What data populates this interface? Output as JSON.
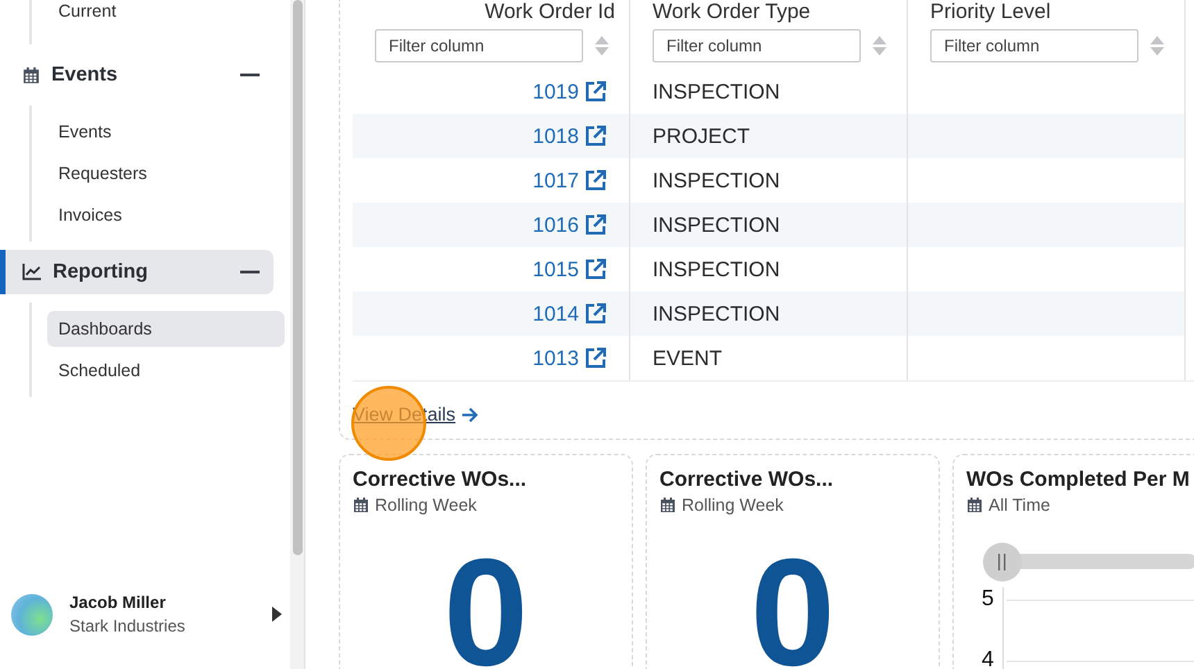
{
  "sidebar": {
    "top_items": [
      {
        "label": "Current",
        "selected": false
      }
    ],
    "groups": [
      {
        "title": "Events",
        "expanded": true,
        "selected": false,
        "items": [
          {
            "label": "Events",
            "selected": false
          },
          {
            "label": "Requesters",
            "selected": false
          },
          {
            "label": "Invoices",
            "selected": false
          }
        ]
      },
      {
        "title": "Reporting",
        "expanded": true,
        "selected": true,
        "items": [
          {
            "label": "Dashboards",
            "selected": true
          },
          {
            "label": "Scheduled",
            "selected": false
          }
        ]
      }
    ],
    "user": {
      "name": "Jacob Miller",
      "company": "Stark Industries"
    }
  },
  "table": {
    "columns": [
      {
        "label": "Work Order Id",
        "placeholder": "Filter column"
      },
      {
        "label": "Work Order Type",
        "placeholder": "Filter column"
      },
      {
        "label": "Priority Level",
        "placeholder": "Filter column"
      }
    ],
    "rows": [
      {
        "id": "1019",
        "type": "INSPECTION"
      },
      {
        "id": "1018",
        "type": "PROJECT"
      },
      {
        "id": "1017",
        "type": "INSPECTION"
      },
      {
        "id": "1016",
        "type": "INSPECTION"
      },
      {
        "id": "1015",
        "type": "INSPECTION"
      },
      {
        "id": "1014",
        "type": "INSPECTION"
      },
      {
        "id": "1013",
        "type": "EVENT"
      }
    ],
    "link": "View Details"
  },
  "cards": [
    {
      "kind": "number",
      "title": "Corrective WOs...",
      "period": "Rolling Week",
      "value": "0"
    },
    {
      "kind": "number",
      "title": "Corrective WOs...",
      "period": "Rolling Week",
      "value": "0"
    },
    {
      "kind": "chart",
      "title": "WOs Completed Per M",
      "period": "All Time",
      "slider": {
        "level": 0
      },
      "y_labels": [
        "5",
        "4"
      ]
    }
  ]
}
